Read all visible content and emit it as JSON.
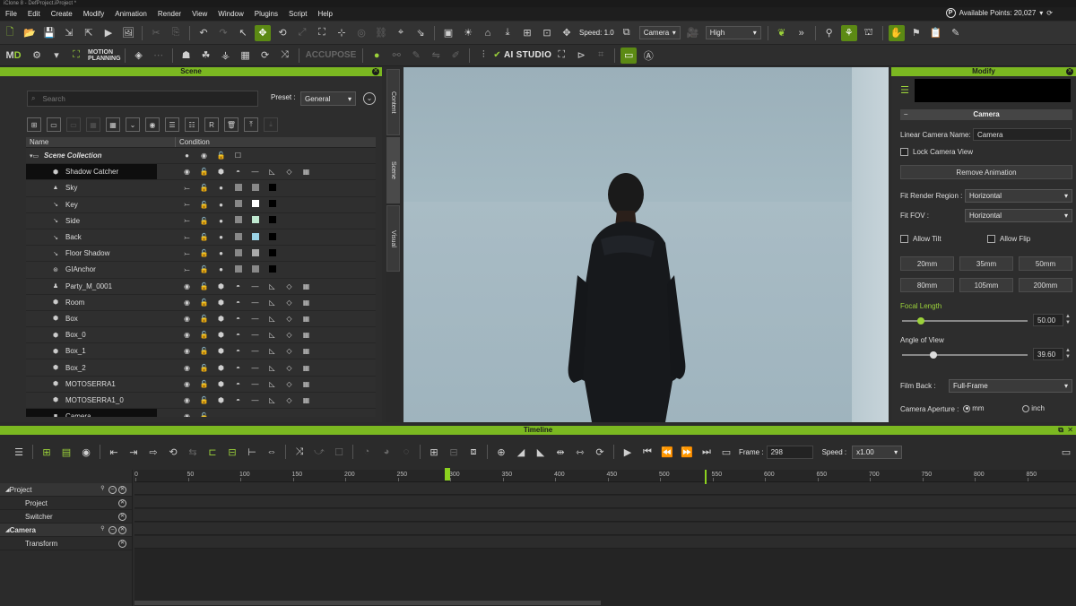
{
  "window": {
    "title": "iClone 8 - DefProject.iProject *"
  },
  "menu": [
    "File",
    "Edit",
    "Create",
    "Modify",
    "Animation",
    "Render",
    "View",
    "Window",
    "Plugins",
    "Script",
    "Help"
  ],
  "points": {
    "icon": "P",
    "label": "Available Points: 20,027"
  },
  "toolbar": {
    "speed_label": "Speed: 1.0",
    "camera_dd": "Camera",
    "quality_dd": "High",
    "motion_planning_line1": "MOTION",
    "motion_planning_line2": "PLANNING",
    "accupose": "ACCUPOSE",
    "ai_studio": "AI STUDIO",
    "mo_label": "M"
  },
  "scene": {
    "header": "Scene",
    "search_placeholder": "Search",
    "preset_label": "Preset :",
    "preset_value": "General",
    "col_name": "Name",
    "col_condition": "Condition",
    "rows": [
      {
        "name": "Scene Collection",
        "bold": true
      },
      {
        "name": "Shadow Catcher"
      },
      {
        "name": "Sky"
      },
      {
        "name": "Key"
      },
      {
        "name": "Side"
      },
      {
        "name": "Back"
      },
      {
        "name": "Floor Shadow"
      },
      {
        "name": "GIAnchor"
      },
      {
        "name": "Party_M_0001"
      },
      {
        "name": "Room"
      },
      {
        "name": "Box"
      },
      {
        "name": "Box_0"
      },
      {
        "name": "Box_1"
      },
      {
        "name": "Box_2"
      },
      {
        "name": "MOTOSERRA1"
      },
      {
        "name": "MOTOSERRA1_0"
      },
      {
        "name": "Camera"
      }
    ]
  },
  "vtabs": [
    "Content",
    "Scene",
    "Visual"
  ],
  "modify": {
    "header": "Modify",
    "section": "Camera",
    "linear_camera_name_label": "Linear Camera Name:",
    "linear_camera_name_value": "Camera",
    "lock_camera_view": "Lock Camera View",
    "remove_animation": "Remove  Animation",
    "fit_render_region_label": "Fit Render Region  :",
    "fit_render_region_value": "Horizontal",
    "fit_fov_label": "Fit FOV  :",
    "fit_fov_value": "Horizontal",
    "allow_tilt": "Allow Tilt",
    "allow_flip": "Allow Flip",
    "lens_buttons": [
      "20mm",
      "35mm",
      "50mm",
      "80mm",
      "105mm",
      "200mm"
    ],
    "focal_length_label": "Focal Length",
    "focal_length_value": "50.00",
    "focal_length_fraction": 0.15,
    "angle_of_view_label": "Angle of View",
    "angle_of_view_value": "39.60",
    "angle_of_view_fraction": 0.25,
    "film_back_label": "Film Back  :",
    "film_back_value": "Full-Frame",
    "aperture_label": "Camera Aperture  :",
    "aperture_mm": "mm",
    "aperture_inch": "inch"
  },
  "timeline": {
    "header": "Timeline",
    "frame_label": "Frame :",
    "frame_value": "298",
    "speed_label": "Speed :",
    "speed_value": "x1.00",
    "ruler": [
      "0",
      "50",
      "100",
      "150",
      "200",
      "250",
      "300",
      "350",
      "400",
      "450",
      "500",
      "550",
      "600",
      "650",
      "700",
      "750",
      "800",
      "850"
    ],
    "tracks": [
      {
        "label": "Project",
        "group": true
      },
      {
        "label": "Project",
        "group": false
      },
      {
        "label": "Switcher",
        "group": false
      },
      {
        "label": "Camera",
        "group": true
      },
      {
        "label": "Transform",
        "group": false
      }
    ]
  },
  "colors": {
    "accent": "#7bb821",
    "active": "#5c8a14"
  }
}
